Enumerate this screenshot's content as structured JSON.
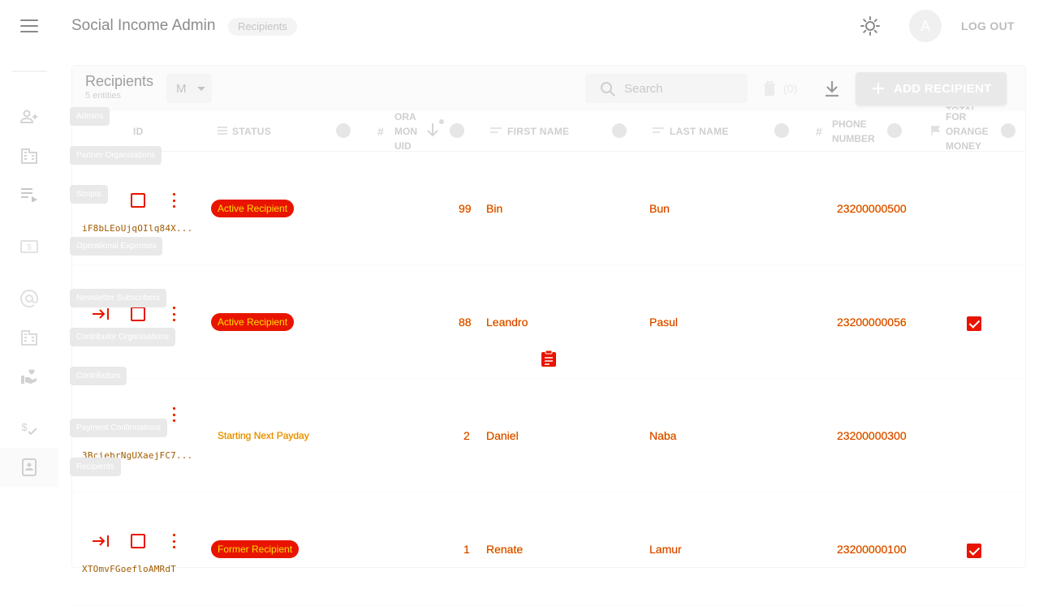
{
  "app": {
    "title": "Social Income Admin",
    "breadcrumb": "Recipients",
    "avatar_letter": "A",
    "logout_label": "LOG OUT"
  },
  "sidebar": {
    "items": [
      {
        "icon": "admins-icon",
        "tooltip": "Admins"
      },
      {
        "icon": "partner-organisations-icon",
        "tooltip": "Partner Organisations"
      },
      {
        "icon": "scripts-icon",
        "tooltip": "Scripts"
      },
      {
        "icon": "operational-expenses-icon",
        "tooltip": "Operational Expenses"
      },
      {
        "icon": "newsletter-subscribers-icon",
        "tooltip": "Newsletter Subscribers"
      },
      {
        "icon": "contributor-organisations-icon",
        "tooltip": "Contributor Organisations"
      },
      {
        "icon": "contributors-icon",
        "tooltip": "Contributors"
      },
      {
        "icon": "payment-confirmations-icon",
        "tooltip": "Payment Confirmations"
      },
      {
        "icon": "recipients-icon",
        "tooltip": "Recipients"
      }
    ]
  },
  "collection": {
    "title": "Recipients",
    "count": "5 entities",
    "view_mode": "M",
    "search_placeholder": "Search",
    "delete_count": "(0)",
    "add_label": "ADD RECIPIENT"
  },
  "columns": {
    "id": "ID",
    "status": "STATUS",
    "om_uid": [
      "ORA",
      "MON",
      "UID"
    ],
    "first_name": "FIRST NAME",
    "last_name": "LAST NAME",
    "phone": [
      "PHONE",
      "NUMBER"
    ],
    "orange": [
      "TOTAL",
      "FOR",
      "ORANGE",
      "MONEY"
    ]
  },
  "rows": [
    {
      "id": "iF8bLEoUjqOIlq84X...",
      "status": "Active Recipient",
      "status_style": "badge",
      "om_uid": "99",
      "first_name": "Bin",
      "last_name": "Bun",
      "phone": "23200000500",
      "orange_money": false
    },
    {
      "id": "",
      "status": "Active Recipient",
      "status_style": "badge",
      "om_uid": "88",
      "first_name": "Leandro",
      "last_name": "Pasul",
      "phone": "23200000056",
      "orange_money": true
    },
    {
      "id": "3BciebrNgUXaejFC7...",
      "status": "Starting Next Payday",
      "status_style": "plain",
      "om_uid": "2",
      "first_name": "Daniel",
      "last_name": "Naba",
      "phone": "23200000300",
      "orange_money": false
    },
    {
      "id": "XTOmvFGoefloAMRdT",
      "status": "Former Recipient",
      "status_style": "badge",
      "om_uid": "1",
      "first_name": "Renate",
      "last_name": "Lamur",
      "phone": "23200000100",
      "orange_money": true
    }
  ],
  "colors": {
    "badge_bg": "#e81400",
    "badge_text": "#ffdf00",
    "cell_text": "#d83a00"
  }
}
